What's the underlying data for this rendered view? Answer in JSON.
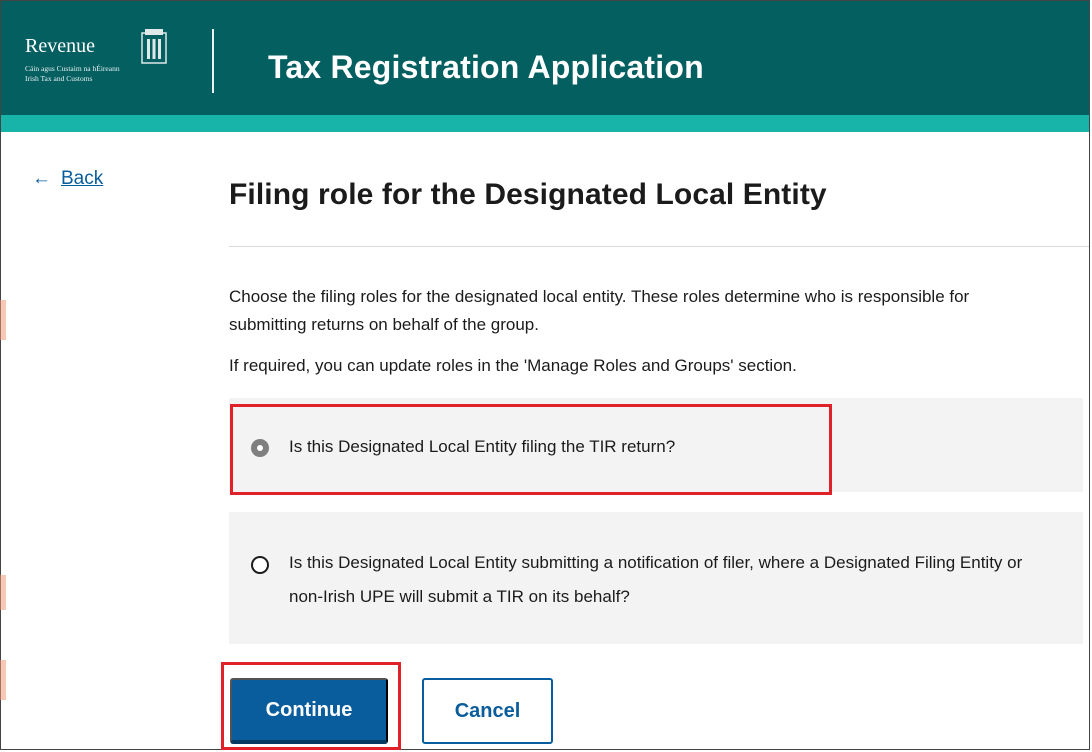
{
  "header": {
    "logo_word": "Revenue",
    "logo_sub_line1": "Cáin agus Custaim na hÉireann",
    "logo_sub_line2": "Irish Tax and Customs",
    "app_title": "Tax Registration Application"
  },
  "nav": {
    "back_arrow": "←",
    "back_label": "Back"
  },
  "page": {
    "title": "Filing role for the Designated Local Entity",
    "description": "Choose the filing roles for the designated local entity. These roles determine who is responsible for submitting returns on behalf of the group.",
    "note": "If required, you can update roles in the 'Manage Roles and Groups' section."
  },
  "options": [
    {
      "label": "Is this Designated Local Entity filing the TIR return?",
      "selected": true
    },
    {
      "label": "Is this Designated Local Entity submitting a notification of filer, where a Designated Filing Entity or non-Irish UPE will submit a TIR on its behalf?",
      "selected": false
    }
  ],
  "actions": {
    "continue_label": "Continue",
    "cancel_label": "Cancel"
  },
  "colors": {
    "header_bg": "#045f61",
    "header_stripe": "#18b3a9",
    "primary_button": "#0a5d9c",
    "highlight_border": "#e0212a"
  }
}
